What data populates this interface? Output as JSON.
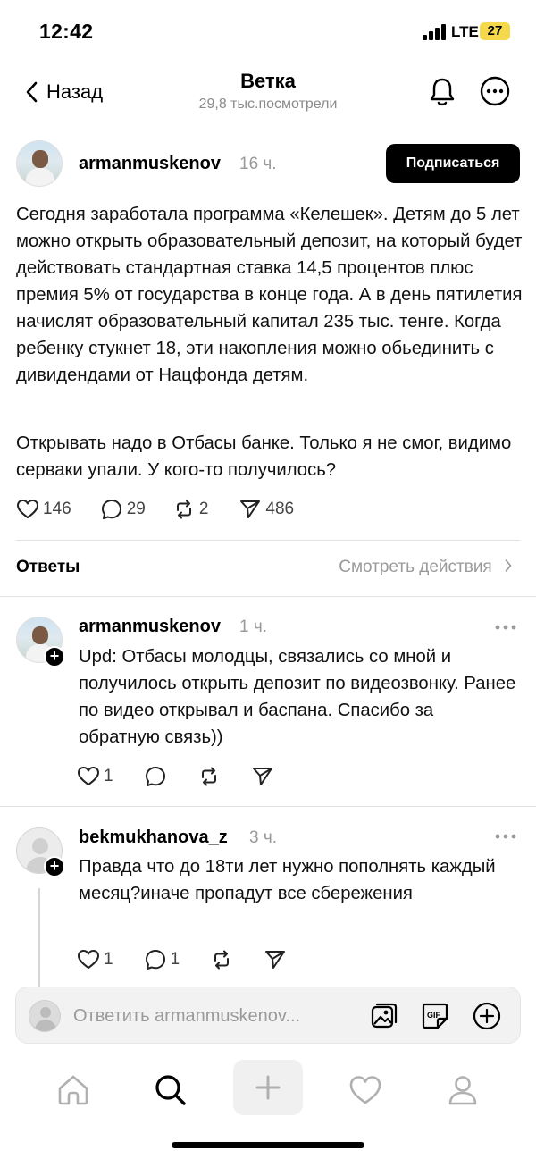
{
  "status_bar": {
    "time": "12:42",
    "network": "LTE",
    "battery": "27"
  },
  "header": {
    "back_label": "Назад",
    "title": "Ветка",
    "subtitle": "29,8 тыс.посмотрели"
  },
  "post": {
    "username": "armanmuskenov",
    "time_ago": "16 ч.",
    "subscribe_label": "Подписаться",
    "paragraph1": "Сегодня заработала программа «Келешек». Детям до 5 лет можно открыть образовательный депозит, на который будет действовать стандартная ставка 14,5 процентов плюс премия 5% от государства в конце года. А в день пятилетия начислят образовательный капитал 235 тыс. тенге. Когда ребенку стукнет 18, эти накопления можно обьединить с дивидендами от Нацфонда детям.",
    "paragraph2": "Открывать надо в Отбасы банке. Только я не смог, видимо серваки упали. У кого-то получилось?",
    "likes": "146",
    "comments": "29",
    "reposts": "2",
    "shares": "486"
  },
  "replies_section": {
    "label": "Ответы",
    "view_activity": "Смотреть действия"
  },
  "replies": [
    {
      "username": "armanmuskenov",
      "time_ago": "1 ч.",
      "text": "Upd: Отбасы молодцы, связались со мной и получилось открыть депозит по видеозвонку. Ранее по видео открывал и баспана. Спасибо за обратную связь))",
      "likes": "1"
    },
    {
      "username": "bekmukhanova_z",
      "time_ago": "3 ч.",
      "text": "Правда что до 18ти лет нужно пополнять каждый месяц?иначе пропадут все сбережения",
      "likes": "1",
      "comments": "1"
    }
  ],
  "compose": {
    "placeholder": "Ответить armanmuskenov..."
  },
  "icons": {
    "back": "chevron-left-icon",
    "notifications": "bell-icon",
    "more": "more-icon",
    "like": "heart-icon",
    "comment": "comment-icon",
    "repost": "repost-icon",
    "share": "send-icon",
    "gallery": "gallery-icon",
    "gif": "gif-icon",
    "add": "plus-circle-icon",
    "tab_home": "home-icon",
    "tab_search": "search-icon",
    "tab_create": "plus-icon",
    "tab_activity": "heart-icon",
    "tab_profile": "profile-icon"
  },
  "colors": {
    "text": "#000000",
    "secondary": "#9a9a9a",
    "button_bg": "#000000",
    "battery": "#f5d94a"
  }
}
